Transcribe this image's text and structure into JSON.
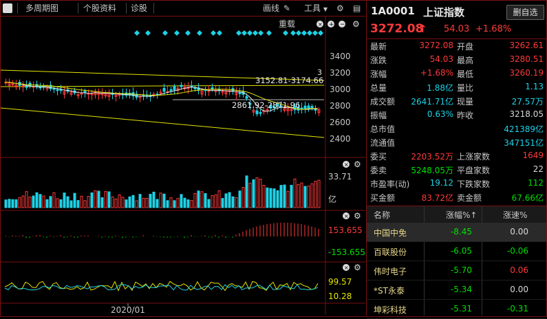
{
  "toolbar": {
    "tabs": [
      "多周期图",
      "个股资料",
      "诊股"
    ],
    "draw_label": "画线",
    "tools_label": "工具"
  },
  "chart": {
    "icons_top": [
      "reload-label",
      "close-icon",
      "plus-icon",
      "minus-icon",
      "gear-icon"
    ],
    "reload_label": "重载",
    "price_axis": [
      "3400",
      "3200",
      "3000",
      "2800",
      "2600",
      "2400"
    ],
    "range_high": "3152.81-3174.66",
    "range_low": "2861.92-2871.96",
    "last_label": "3",
    "volume_max": "33.71",
    "volume_unit": "亿",
    "macd_top": "153.655",
    "macd_bottom": "-153.655",
    "ind3_top": "99.57",
    "ind3_bottom": "10.28",
    "date_label": "2020/01",
    "colors": {
      "up": "#ff3a3a",
      "down": "#1ed2e6",
      "ma1": "#e8e8e8",
      "ma2": "#e6e600",
      "ma3": "#d05cd0"
    }
  },
  "quote": {
    "code": "1A0001",
    "name": "上证指数",
    "watch_button": "删自选",
    "price": "3272.08",
    "change": "54.03",
    "change_pct": "+1.68%",
    "rows": [
      {
        "l1": "最新",
        "v1": "3272.08",
        "c1": "red",
        "l2": "开盘",
        "v2": "3262.61",
        "c2": "red"
      },
      {
        "l1": "涨跌",
        "v1": "54.03",
        "c1": "red",
        "l2": "最高",
        "v2": "3280.51",
        "c2": "red"
      },
      {
        "l1": "涨幅",
        "v1": "+1.68%",
        "c1": "red",
        "l2": "最低",
        "v2": "3260.19",
        "c2": "red"
      },
      {
        "l1": "总量",
        "v1": "1.88亿",
        "c1": "cyan",
        "l2": "量比",
        "v2": "1.13",
        "c2": "cyan"
      },
      {
        "l1": "成交额",
        "v1": "2641.71亿",
        "c1": "cyan",
        "l2": "现量",
        "v2": "27.57万",
        "c2": "cyan"
      },
      {
        "l1": "振幅",
        "v1": "0.63%",
        "c1": "cyan",
        "l2": "昨收",
        "v2": "3218.05",
        "c2": "white"
      },
      {
        "l1": "总市值",
        "v1": "",
        "c1": "white",
        "l2": "",
        "v2": "421389亿",
        "c2": "cyan"
      },
      {
        "l1": "流通值",
        "v1": "",
        "c1": "white",
        "l2": "",
        "v2": "347151亿",
        "c2": "cyan"
      },
      {
        "l1": "委买",
        "v1": "2203.52万",
        "c1": "red",
        "l2": "上涨家数",
        "v2": "1649",
        "c2": "red"
      },
      {
        "l1": "委卖",
        "v1": "5248.05万",
        "c1": "green",
        "l2": "平盘家数",
        "v2": "22",
        "c2": "white"
      },
      {
        "l1": "市盈率(动)",
        "v1": "19.12",
        "c1": "cyan",
        "l2": "下跌家数",
        "v2": "112",
        "c2": "green"
      },
      {
        "l1": "买金额",
        "v1": "83.72亿",
        "c1": "red",
        "l2": "卖金额",
        "v2": "67.66亿",
        "c2": "green"
      }
    ],
    "list_headers": [
      "名称",
      "涨幅%↑",
      "涨速%"
    ],
    "list": [
      {
        "name": "中国中免",
        "pct": "-8.45",
        "speed": "0.00",
        "sc": "white"
      },
      {
        "name": "百联股份",
        "pct": "-6.05",
        "speed": "-0.06",
        "sc": "green"
      },
      {
        "name": "伟时电子",
        "pct": "-5.70",
        "speed": "0.06",
        "sc": "red"
      },
      {
        "name": "*ST永泰",
        "pct": "-5.34",
        "speed": "0.00",
        "sc": "white"
      },
      {
        "name": "坤彩科技",
        "pct": "-5.31",
        "speed": "-0.31",
        "sc": "green"
      }
    ]
  }
}
